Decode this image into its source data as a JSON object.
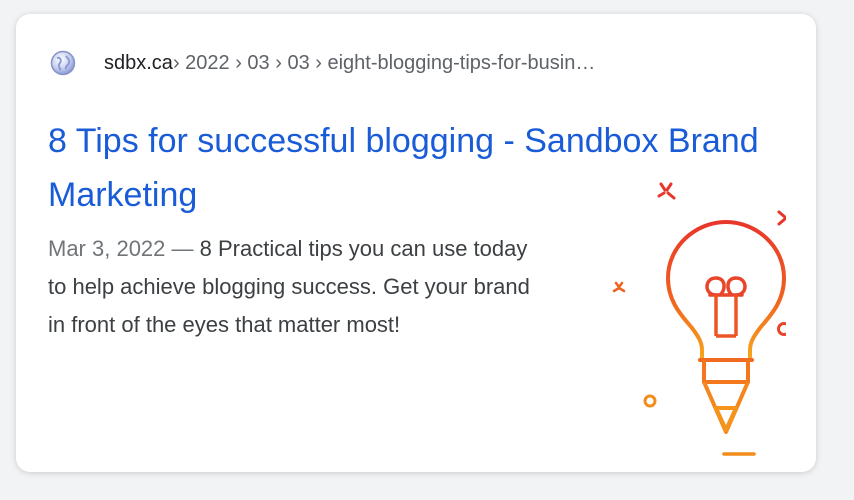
{
  "result": {
    "favicon": "globe-icon",
    "domain": "sdbx.ca",
    "path": " › 2022 › 03 › 03 › eight-blogging-tips-for-busin…",
    "title": "8 Tips for successful blogging - Sandbox Brand Marketing",
    "date": "Mar 3, 2022",
    "separator": " — ",
    "snippet": "8 Practical tips you can use today to help achieve blogging success. Get your brand in front of the eyes that matter most!",
    "thumbnail": "lightbulb-pen-icon"
  },
  "colors": {
    "title": "#1a5cd7",
    "domain": "#202124",
    "path": "#5f6368",
    "snippet": "#3c4043",
    "date": "#70757a",
    "illustration_red": "#e8362b",
    "illustration_orange": "#f28c1c",
    "illustration_yellow": "#f7b51d"
  }
}
